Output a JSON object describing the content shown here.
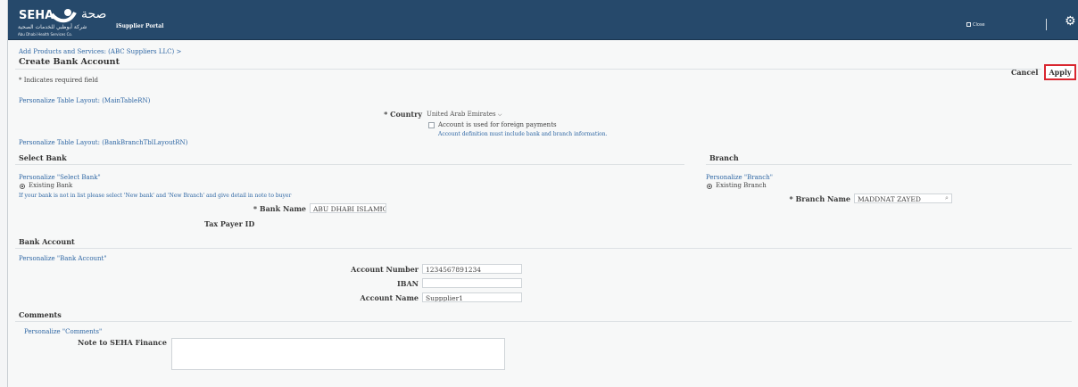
{
  "header": {
    "logo_text": "SEHA",
    "logo_arabic": "صحة",
    "portal_name": "iSupplier Portal",
    "logo_subtitle_ar": "شركة أبوظبي للخدمات الصحية",
    "logo_subtitle_en": "Abu Dhabi Health Services Co.",
    "close_label": "Close"
  },
  "breadcrumb": {
    "items": [
      "Add Products and Services: (ABC Suppliers LLC)",
      ">"
    ]
  },
  "page_title": "Create Bank Account",
  "actions": {
    "cancel": "Cancel",
    "apply": "Apply"
  },
  "required_note": "* Indicates required field",
  "personalize": {
    "main_table": "Personalize Table Layout: (MainTableRN)",
    "bank_branch_table": "Personalize Table Layout: (BankBranchTblLayoutRN)",
    "select_bank": "Personalize \"Select Bank\"",
    "branch": "Personalize \"Branch\"",
    "bank_account": "Personalize \"Bank Account\"",
    "comments": "Personalize \"Comments\""
  },
  "country": {
    "label": "* Country",
    "value": "United Arab Emirates",
    "foreign_checkbox_label": "Account is used for foreign payments",
    "foreign_checked": false,
    "hint": "Account definition must include bank and branch information."
  },
  "select_bank": {
    "heading": "Select Bank",
    "radio_label": "Existing Bank",
    "instruction": "If your bank is not in list please select 'New bank' and 'New Branch' and give detail in note to buyer",
    "bank_name_label": "* Bank Name",
    "bank_name_value": "ABU DHABI ISLAMIC",
    "tax_payer_label": "Tax Payer ID"
  },
  "branch": {
    "heading": "Branch",
    "radio_label": "Existing Branch",
    "branch_name_label": "* Branch Name",
    "branch_name_value": "MADDNAT ZAYED"
  },
  "bank_account": {
    "heading": "Bank Account",
    "account_number_label": "Account Number",
    "account_number_value": "1234567891234",
    "iban_label": "IBAN",
    "iban_value": "",
    "account_name_label": "Account Name",
    "account_name_value": "Suppplier1"
  },
  "comments": {
    "heading": "Comments",
    "note_label": "Note to SEHA Finance",
    "note_value": ""
  },
  "colors": {
    "header_bg": "#26496b",
    "link": "#2f67a4",
    "apply_highlight": "#d9262f"
  }
}
